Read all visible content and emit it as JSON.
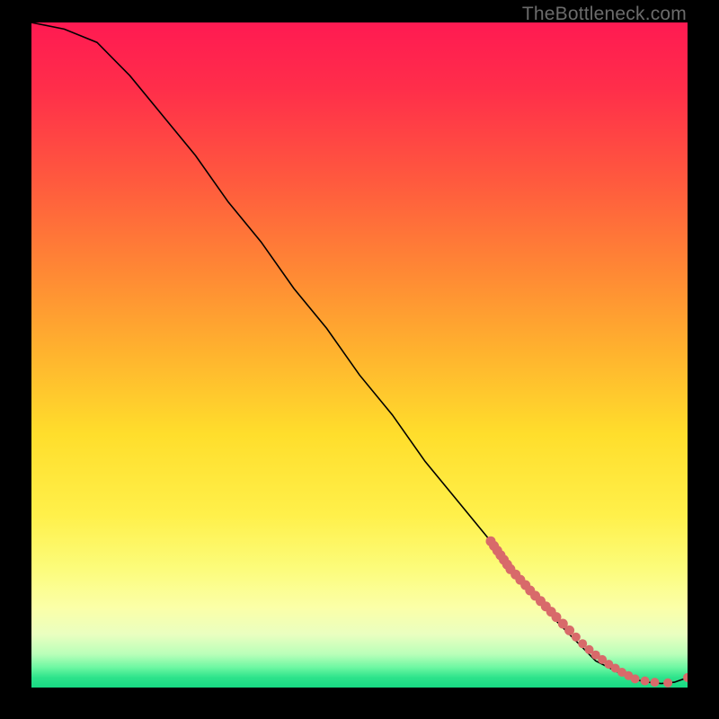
{
  "watermark": "TheBottleneck.com",
  "colors": {
    "curve": "#000000",
    "dot": "#d86a6a",
    "frame": "#000000"
  },
  "chart_data": {
    "type": "line",
    "title": "",
    "xlabel": "",
    "ylabel": "",
    "xlim": [
      0,
      100
    ],
    "ylim": [
      0,
      100
    ],
    "grid": false,
    "legend": false,
    "series": [
      {
        "name": "bottleneck-curve",
        "x": [
          0,
          5,
          10,
          15,
          20,
          25,
          30,
          35,
          40,
          45,
          50,
          55,
          60,
          65,
          70,
          75,
          80,
          82,
          84,
          86,
          88,
          90,
          92,
          94,
          96,
          98,
          100
        ],
        "y": [
          100,
          99,
          97,
          92,
          86,
          80,
          73,
          67,
          60,
          54,
          47,
          41,
          34,
          28,
          22,
          16,
          10,
          8,
          6,
          4,
          3,
          2,
          1.2,
          0.8,
          0.6,
          0.8,
          1.5
        ]
      }
    ],
    "markers": {
      "name": "sample-points",
      "x": [
        70,
        70.5,
        71,
        71.5,
        72,
        72.5,
        73,
        73.8,
        74.5,
        75.3,
        76,
        76.8,
        77.6,
        78.4,
        79.2,
        80,
        81,
        82,
        83,
        84,
        85,
        86,
        87,
        88,
        89,
        90,
        91,
        92,
        93.5,
        95,
        97,
        100
      ],
      "y": [
        22,
        21.3,
        20.6,
        19.9,
        19.2,
        18.5,
        17.8,
        17,
        16.2,
        15.4,
        14.6,
        13.8,
        13,
        12.2,
        11.4,
        10.6,
        9.6,
        8.6,
        7.6,
        6.6,
        5.7,
        4.9,
        4.2,
        3.5,
        2.9,
        2.3,
        1.8,
        1.3,
        1,
        0.8,
        0.7,
        1.5
      ]
    }
  }
}
